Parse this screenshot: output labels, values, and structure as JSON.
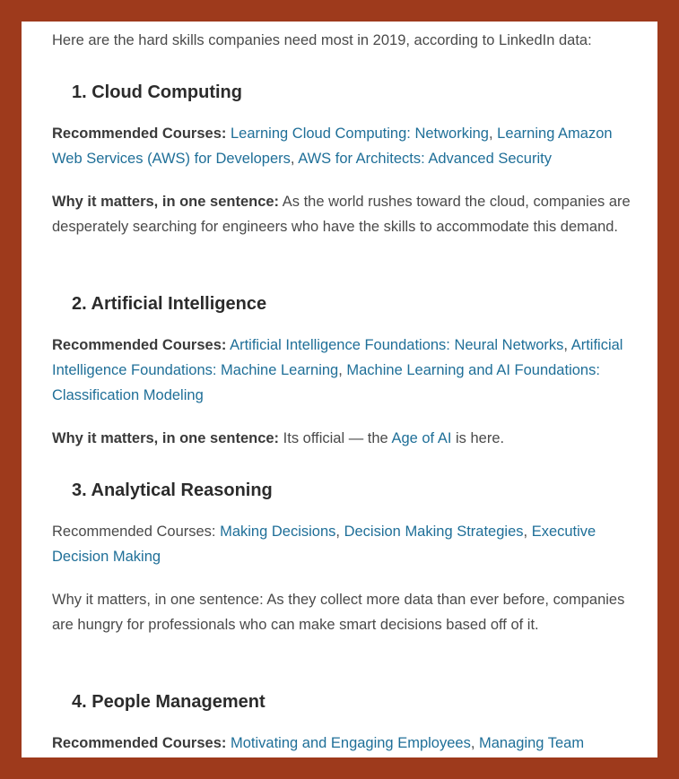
{
  "intro": "Here are the hard skills companies need most in 2019, according to LinkedIn data:",
  "sections": [
    {
      "heading": "1. Cloud Computing",
      "courses_label": "Recommended Courses:",
      "courses": [
        "Learning Cloud Computing: Networking",
        "Learning Amazon Web Services (AWS) for Developers",
        "AWS for Architects: Advanced Security"
      ],
      "why_label": "Why it matters, in one sentence:",
      "why_text": "As the world rushes toward the cloud, companies are desperately searching for engineers who have the skills to accommodate this demand."
    },
    {
      "heading": "2. Artificial Intelligence",
      "courses_label": "Recommended Courses:",
      "courses": [
        "Artificial Intelligence Foundations: Neural Networks",
        "Artificial Intelligence Foundations: Machine Learning",
        "Machine Learning and AI Foundations: Classification Modeling"
      ],
      "why_label": "Why it matters, in one sentence:",
      "why_before": "Its official — the",
      "why_link": "Age of AI",
      "why_after": "is here."
    },
    {
      "heading": "3. Analytical Reasoning",
      "courses_label": "Recommended Courses:",
      "courses": [
        "Making Decisions",
        "Decision Making Strategies",
        "Executive Decision Making"
      ],
      "why_label": "Why it matters, in one sentence:",
      "why_text": "As they collect more data than ever before, companies are hungry for professionals who can make smart decisions based off of it."
    },
    {
      "heading": "4. People Management",
      "courses_label": "Recommended Courses:",
      "courses": [
        "Motivating and Engaging Employees",
        "Managing Team"
      ]
    }
  ]
}
